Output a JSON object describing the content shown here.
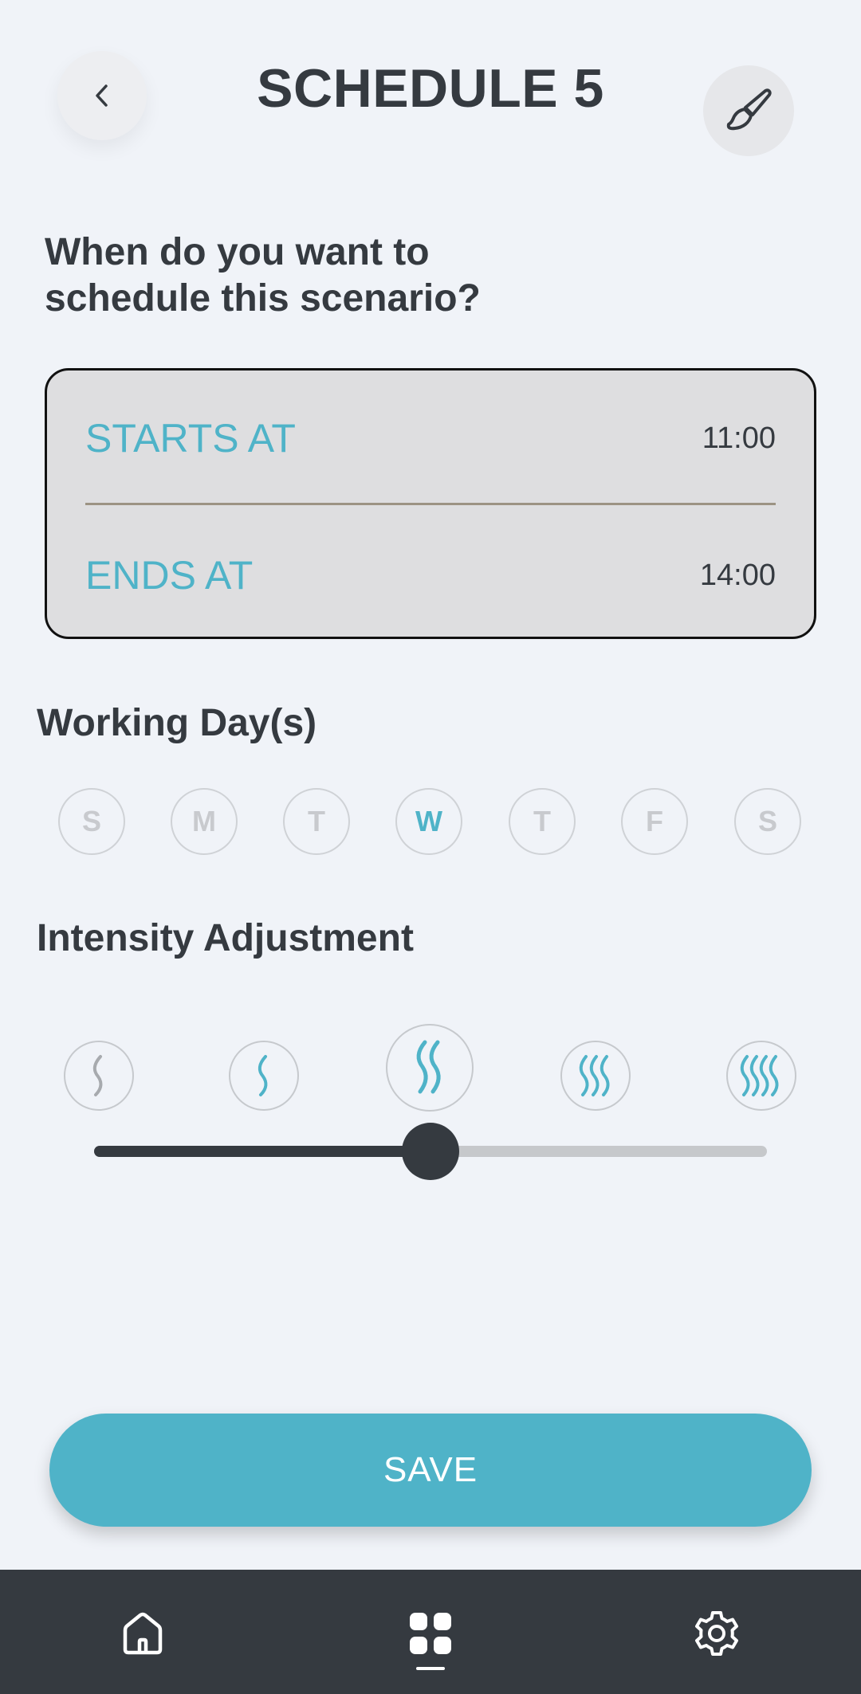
{
  "header": {
    "title": "SCHEDULE 5",
    "back_icon": "chevron-left-icon",
    "edit_icon": "paintbrush-icon"
  },
  "question": {
    "line1": "When do you want to",
    "line2": "schedule this scenario?"
  },
  "schedule": {
    "starts_label": "STARTS AT",
    "starts_value": "11:00",
    "ends_label": "ENDS AT",
    "ends_value": "14:00"
  },
  "working_days": {
    "title": "Working Day(s)",
    "days": [
      {
        "label": "S",
        "selected": false
      },
      {
        "label": "M",
        "selected": false
      },
      {
        "label": "T",
        "selected": false
      },
      {
        "label": "W",
        "selected": true
      },
      {
        "label": "T",
        "selected": false
      },
      {
        "label": "F",
        "selected": false
      },
      {
        "label": "S",
        "selected": false
      }
    ]
  },
  "intensity": {
    "title": "Intensity Adjustment",
    "levels": 5,
    "selected_level": 3,
    "slider_fraction": 0.5
  },
  "save": {
    "label": "SAVE"
  },
  "bottom_nav": {
    "items": [
      "home-icon",
      "dashboard-grid-icon",
      "settings-gear-icon"
    ],
    "active": 1
  },
  "colors": {
    "accent": "#4fb3c8",
    "dark": "#353a40",
    "background": "#f0f3f8",
    "inactive": "#c8cace"
  }
}
